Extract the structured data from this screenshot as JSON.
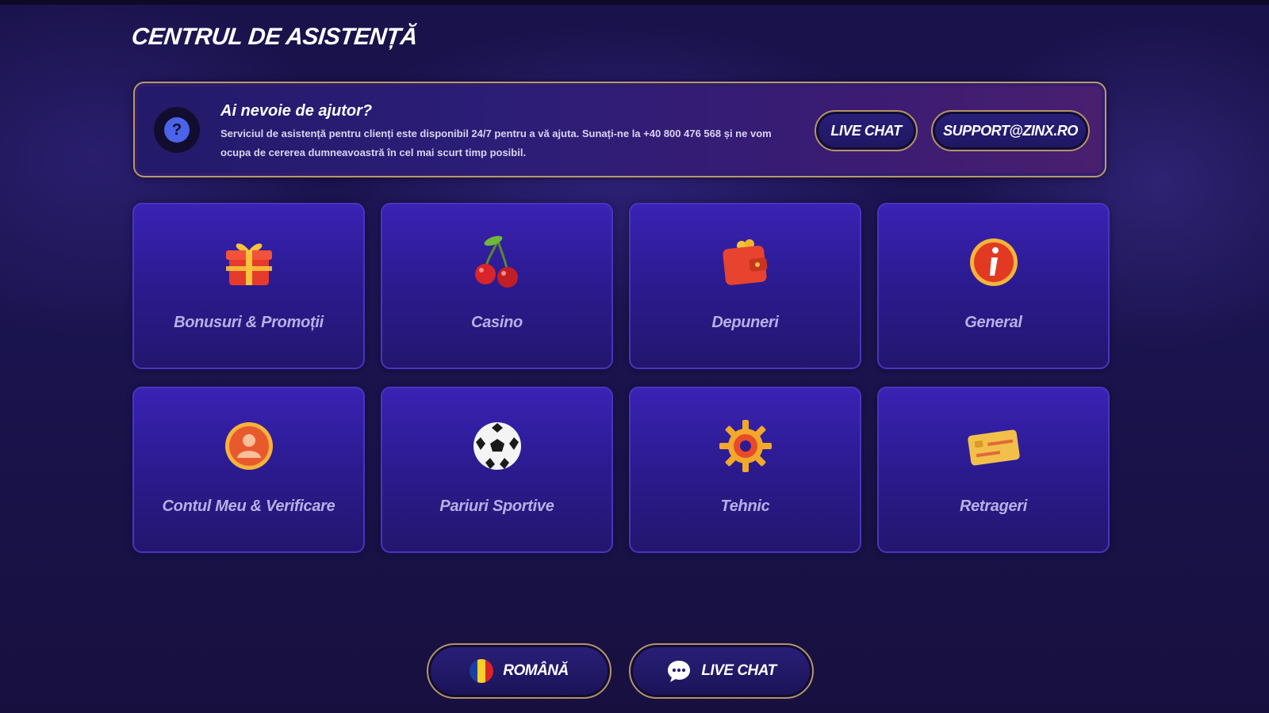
{
  "page": {
    "title": "CENTRUL DE ASISTENȚĂ"
  },
  "help_banner": {
    "icon": "question-icon",
    "heading": "Ai nevoie de ajutor?",
    "text": "Serviciul de asistență pentru clienți este disponibil 24/7 pentru a vă ajuta. Sunați-ne la +40 800 476 568 și ne vom ocupa de cererea dumneavoastră în cel mai scurt timp posibil.",
    "live_chat_label": "LIVE CHAT",
    "email_label": "SUPPORT@ZINX.RO"
  },
  "categories": [
    {
      "label": "Bonusuri & Promoții",
      "icon": "gift-icon"
    },
    {
      "label": "Casino",
      "icon": "cherries-icon"
    },
    {
      "label": "Depuneri",
      "icon": "wallet-icon"
    },
    {
      "label": "General",
      "icon": "info-icon"
    },
    {
      "label": "Contul Meu & Verificare",
      "icon": "user-icon"
    },
    {
      "label": "Pariuri Sportive",
      "icon": "soccer-ball-icon"
    },
    {
      "label": "Tehnic",
      "icon": "gear-icon"
    },
    {
      "label": "Retrageri",
      "icon": "credit-card-icon"
    }
  ],
  "footer": {
    "language_label": "ROMÂNĂ",
    "language_icon": "romania-flag-icon",
    "chat_label": "LIVE CHAT",
    "chat_icon": "chat-bubble-icon"
  },
  "colors": {
    "background": "#1b1450",
    "card": "#2c1b92",
    "accent_border": "#b49468",
    "label": "#b6b0e6"
  }
}
